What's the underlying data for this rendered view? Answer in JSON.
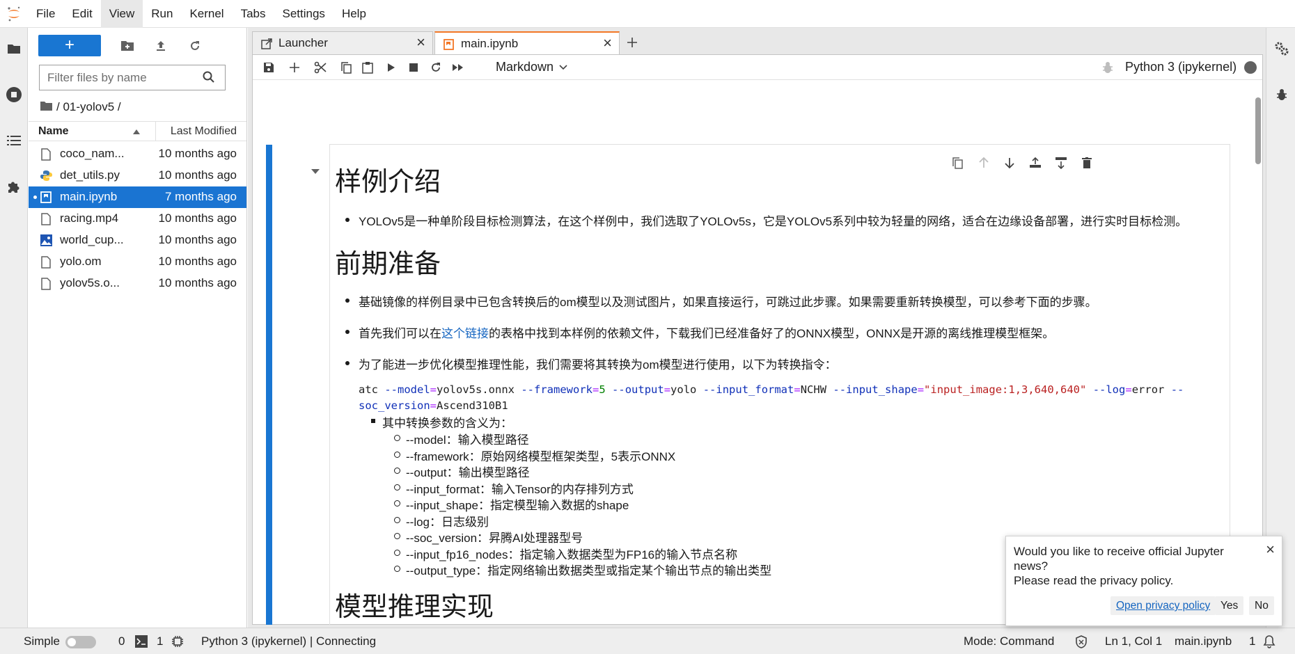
{
  "menubar": {
    "items": [
      "File",
      "Edit",
      "View",
      "Run",
      "Kernel",
      "Tabs",
      "Settings",
      "Help"
    ],
    "active": "View"
  },
  "filebrowser": {
    "new_label": "+",
    "filter_placeholder": "Filter files by name",
    "breadcrumb": "/ 01-yolov5 /",
    "col_name": "Name",
    "col_modified": "Last Modified",
    "files": [
      {
        "name": "coco_nam...",
        "modified": "10 months ago",
        "icon": "file-icon",
        "selected": false
      },
      {
        "name": "det_utils.py",
        "modified": "10 months ago",
        "icon": "python-icon",
        "selected": false
      },
      {
        "name": "main.ipynb",
        "modified": "7 months ago",
        "icon": "notebook-icon",
        "selected": true
      },
      {
        "name": "racing.mp4",
        "modified": "10 months ago",
        "icon": "file-icon",
        "selected": false
      },
      {
        "name": "world_cup...",
        "modified": "10 months ago",
        "icon": "image-icon",
        "selected": false
      },
      {
        "name": "yolo.om",
        "modified": "10 months ago",
        "icon": "file-icon",
        "selected": false
      },
      {
        "name": "yolov5s.o...",
        "modified": "10 months ago",
        "icon": "file-icon",
        "selected": false
      }
    ]
  },
  "tabs": [
    {
      "label": "Launcher",
      "icon": "launcher-icon"
    },
    {
      "label": "main.ipynb",
      "icon": "notebook-icon",
      "current": true
    }
  ],
  "toolbar": {
    "cell_type": "Markdown",
    "kernel": "Python 3 (ipykernel)"
  },
  "notebook": {
    "h1_intro": "样例介绍",
    "intro_bullet": "YOLOv5是一种单阶段目标检测算法，在这个样例中，我们选取了YOLOv5s，它是YOLOv5系列中较为轻量的网络，适合在边缘设备部署，进行实时目标检测。",
    "h1_prep": "前期准备",
    "prep_bullet_1": "基础镜像的样例目录中已包含转换后的om模型以及测试图片，如果直接运行，可跳过此步骤。如果需要重新转换模型，可以参考下面的步骤。",
    "prep_bullet_2_pre": "首先我们可以在",
    "prep_bullet_2_link": "这个链接",
    "prep_bullet_2_post": "的表格中找到本样例的依赖文件，下载我们已经准备好了的ONNX模型，ONNX是开源的离线推理模型框架。",
    "prep_bullet_3": "为了能进一步优化模型推理性能，我们需要将其转换为om模型进行使用，以下为转换指令：",
    "code": {
      "cmd": "atc",
      "model_flag": "--model",
      "model_val": "yolov5s.onnx",
      "framework_flag": "--framework",
      "framework_val": "5",
      "output_flag": "--output",
      "output_val": "yolo",
      "input_format_flag": "--input_format",
      "input_format_val": "NCHW",
      "input_shape_flag": "--input_shape",
      "input_shape_val": "\"input_image:1,3,640,640\"",
      "log_flag": "--log",
      "log_val": "error",
      "dash": "--",
      "soc_flag": "soc_version",
      "soc_val": "Ascend310B1"
    },
    "params_title": "其中转换参数的含义为：",
    "params": [
      "--model：输入模型路径",
      "--framework：原始网络模型框架类型，5表示ONNX",
      "--output：输出模型路径",
      "--input_format：输入Tensor的内存排列方式",
      "--input_shape：指定模型输入数据的shape",
      "--log：日志级别",
      "--soc_version：昇腾AI处理器型号",
      "--input_fp16_nodes：指定输入数据类型为FP16的输入节点名称",
      "--output_type：指定网络输出数据类型或指定某个输出节点的输出类型"
    ],
    "h1_infer": "模型推理实现"
  },
  "statusbar": {
    "mode_simple": "Simple",
    "terminals": "0",
    "kernels": "1",
    "kernel_status": "Python 3 (ipykernel) | Connecting",
    "mode": "Mode: Command",
    "cursor": "Ln 1, Col 1",
    "filename": "main.ipynb",
    "notifications": "1"
  },
  "toast": {
    "message_1": "Would you like to receive official Jupyter news?",
    "message_2": "Please read the privacy policy.",
    "privacy_label": "Open privacy policy",
    "yes_label": "Yes",
    "no_label": "No"
  },
  "colors": {
    "accent": "#1976d2",
    "jupyter_orange": "#f37726"
  }
}
